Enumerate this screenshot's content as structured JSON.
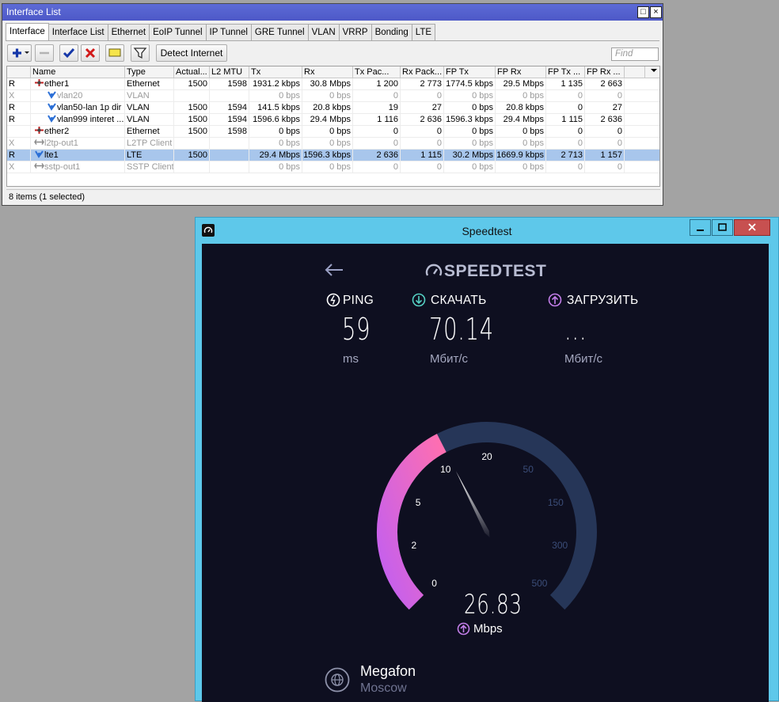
{
  "winbox": {
    "title": "Interface List",
    "title_buttons": [
      "□",
      "×"
    ],
    "tabs": [
      "Interface",
      "Interface List",
      "Ethernet",
      "EoIP Tunnel",
      "IP Tunnel",
      "GRE Tunnel",
      "VLAN",
      "VRRP",
      "Bonding",
      "LTE"
    ],
    "toolbar": {
      "detect_label": "Detect Internet",
      "find_placeholder": "Find"
    },
    "columns": [
      "",
      "Name",
      "Type",
      "Actual...",
      "L2 MTU",
      "Tx",
      "Rx",
      "Tx Pac...",
      "Rx Pack...",
      "FP Tx",
      "FP Rx",
      "FP Tx ...",
      "FP Rx ..."
    ],
    "rows": [
      {
        "flag": "R",
        "name": "ether1",
        "icon": "ethernet-icon",
        "type": "Ethernet",
        "mtu": "1500",
        "l2mtu": "1598",
        "tx": "1931.2 kbps",
        "rx": "30.8 Mbps",
        "txp": "1 200",
        "rxp": "2 773",
        "fptx": "1774.5 kbps",
        "fprx": "29.5 Mbps",
        "fptxp": "1 135",
        "fprxp": "2 663",
        "disabled": false,
        "selected": false,
        "indent": 0
      },
      {
        "flag": "X",
        "name": "vlan20",
        "icon": "vlan-icon",
        "type": "VLAN",
        "mtu": "",
        "l2mtu": "",
        "tx": "0 bps",
        "rx": "0 bps",
        "txp": "0",
        "rxp": "0",
        "fptx": "0 bps",
        "fprx": "0 bps",
        "fptxp": "0",
        "fprxp": "0",
        "disabled": true,
        "selected": false,
        "indent": 1
      },
      {
        "flag": "R",
        "name": "vlan50-lan 1p dir",
        "icon": "vlan-icon",
        "type": "VLAN",
        "mtu": "1500",
        "l2mtu": "1594",
        "tx": "141.5 kbps",
        "rx": "20.8 kbps",
        "txp": "19",
        "rxp": "27",
        "fptx": "0 bps",
        "fprx": "20.8 kbps",
        "fptxp": "0",
        "fprxp": "27",
        "disabled": false,
        "selected": false,
        "indent": 1
      },
      {
        "flag": "R",
        "name": "vlan999 interet ...",
        "icon": "vlan-icon",
        "type": "VLAN",
        "mtu": "1500",
        "l2mtu": "1594",
        "tx": "1596.6 kbps",
        "rx": "29.4 Mbps",
        "txp": "1 116",
        "rxp": "2 636",
        "fptx": "1596.3 kbps",
        "fprx": "29.4 Mbps",
        "fptxp": "1 115",
        "fprxp": "2 636",
        "disabled": false,
        "selected": false,
        "indent": 1
      },
      {
        "flag": "",
        "name": "ether2",
        "icon": "ethernet-icon",
        "type": "Ethernet",
        "mtu": "1500",
        "l2mtu": "1598",
        "tx": "0 bps",
        "rx": "0 bps",
        "txp": "0",
        "rxp": "0",
        "fptx": "0 bps",
        "fprx": "0 bps",
        "fptxp": "0",
        "fprxp": "0",
        "disabled": false,
        "selected": false,
        "indent": 0
      },
      {
        "flag": "X",
        "name": "l2tp-out1",
        "icon": "tunnel-icon",
        "type": "L2TP Client",
        "mtu": "",
        "l2mtu": "",
        "tx": "0 bps",
        "rx": "0 bps",
        "txp": "0",
        "rxp": "0",
        "fptx": "0 bps",
        "fprx": "0 bps",
        "fptxp": "0",
        "fprxp": "0",
        "disabled": true,
        "selected": false,
        "indent": 0
      },
      {
        "flag": "R",
        "name": "lte1",
        "icon": "lte-icon",
        "type": "LTE",
        "mtu": "1500",
        "l2mtu": "",
        "tx": "29.4 Mbps",
        "rx": "1596.3 kbps",
        "txp": "2 636",
        "rxp": "1 115",
        "fptx": "30.2 Mbps",
        "fprx": "1669.9 kbps",
        "fptxp": "2 713",
        "fprxp": "1 157",
        "disabled": false,
        "selected": true,
        "indent": 0
      },
      {
        "flag": "X",
        "name": "sstp-out1",
        "icon": "tunnel-icon",
        "type": "SSTP Client",
        "mtu": "",
        "l2mtu": "",
        "tx": "0 bps",
        "rx": "0 bps",
        "txp": "0",
        "rxp": "0",
        "fptx": "0 bps",
        "fprx": "0 bps",
        "fptxp": "0",
        "fprxp": "0",
        "disabled": true,
        "selected": false,
        "indent": 0
      }
    ],
    "status": "8 items (1 selected)"
  },
  "speedtest": {
    "title": "Speedtest",
    "logo": "SPEEDTEST",
    "ping": {
      "label": "PING",
      "value": "59",
      "unit": "ms"
    },
    "download": {
      "label": "СКАЧАТЬ",
      "value": "70.14",
      "unit": "Мбит/с"
    },
    "upload": {
      "label": "ЗАГРУЗИТЬ",
      "value": "...",
      "unit": "Мбит/с"
    },
    "gauge": {
      "ticks": [
        "0",
        "2",
        "5",
        "10",
        "20",
        "50",
        "150",
        "300",
        "500"
      ],
      "active_ticks": 5,
      "current_value": "26.83",
      "current_unit": "Mbps",
      "fill_fraction": 0.4
    },
    "provider": {
      "name": "Megafon",
      "city": "Moscow"
    },
    "colors": {
      "gradient_start": "#c25ff0",
      "gradient_end": "#ff6fb0",
      "track": "#263658",
      "background": "#0e0f20"
    }
  }
}
